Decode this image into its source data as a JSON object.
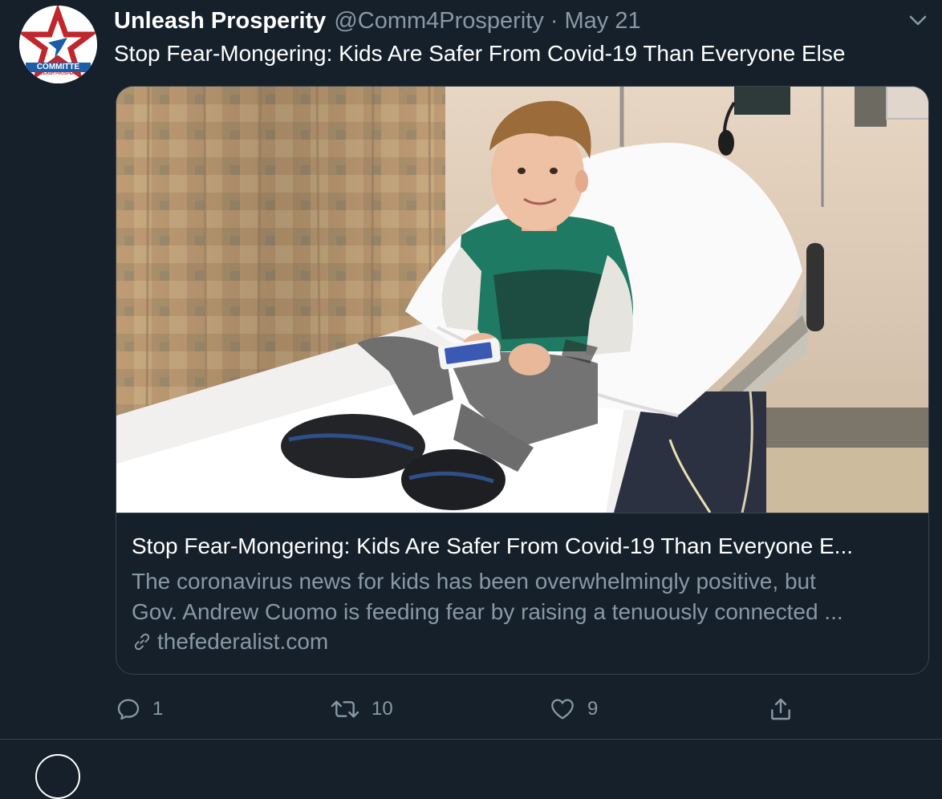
{
  "tweet": {
    "avatar_text": "COMMITTE",
    "avatar_subtext": "UNLEASH PROSPERITY",
    "name": "Unleash Prosperity",
    "handle": "@Comm4Prosperity",
    "separator": "·",
    "date": "May 21",
    "text": "Stop Fear-Mongering: Kids Are Safer From Covid-19 Than Everyone Else"
  },
  "card": {
    "title": "Stop Fear-Mongering: Kids Are Safer From Covid-19 Than Everyone E...",
    "description_line1": "The coronavirus news for kids has been overwhelmingly positive, but",
    "description_line2": "Gov. Andrew Cuomo is feeding fear by raising a tenuously connected ...",
    "domain": "thefederalist.com"
  },
  "actions": {
    "reply_count": "1",
    "retweet_count": "10",
    "like_count": "9"
  },
  "icons": {
    "more": "chevron-down-icon",
    "link": "link-icon",
    "reply": "reply-icon",
    "retweet": "retweet-icon",
    "like": "heart-icon",
    "share": "share-icon"
  },
  "colors": {
    "background": "#15202b",
    "secondary_text": "#8899a6",
    "border": "#38444d",
    "avatar_star": "#c0272d",
    "avatar_blue": "#1d5da8"
  }
}
